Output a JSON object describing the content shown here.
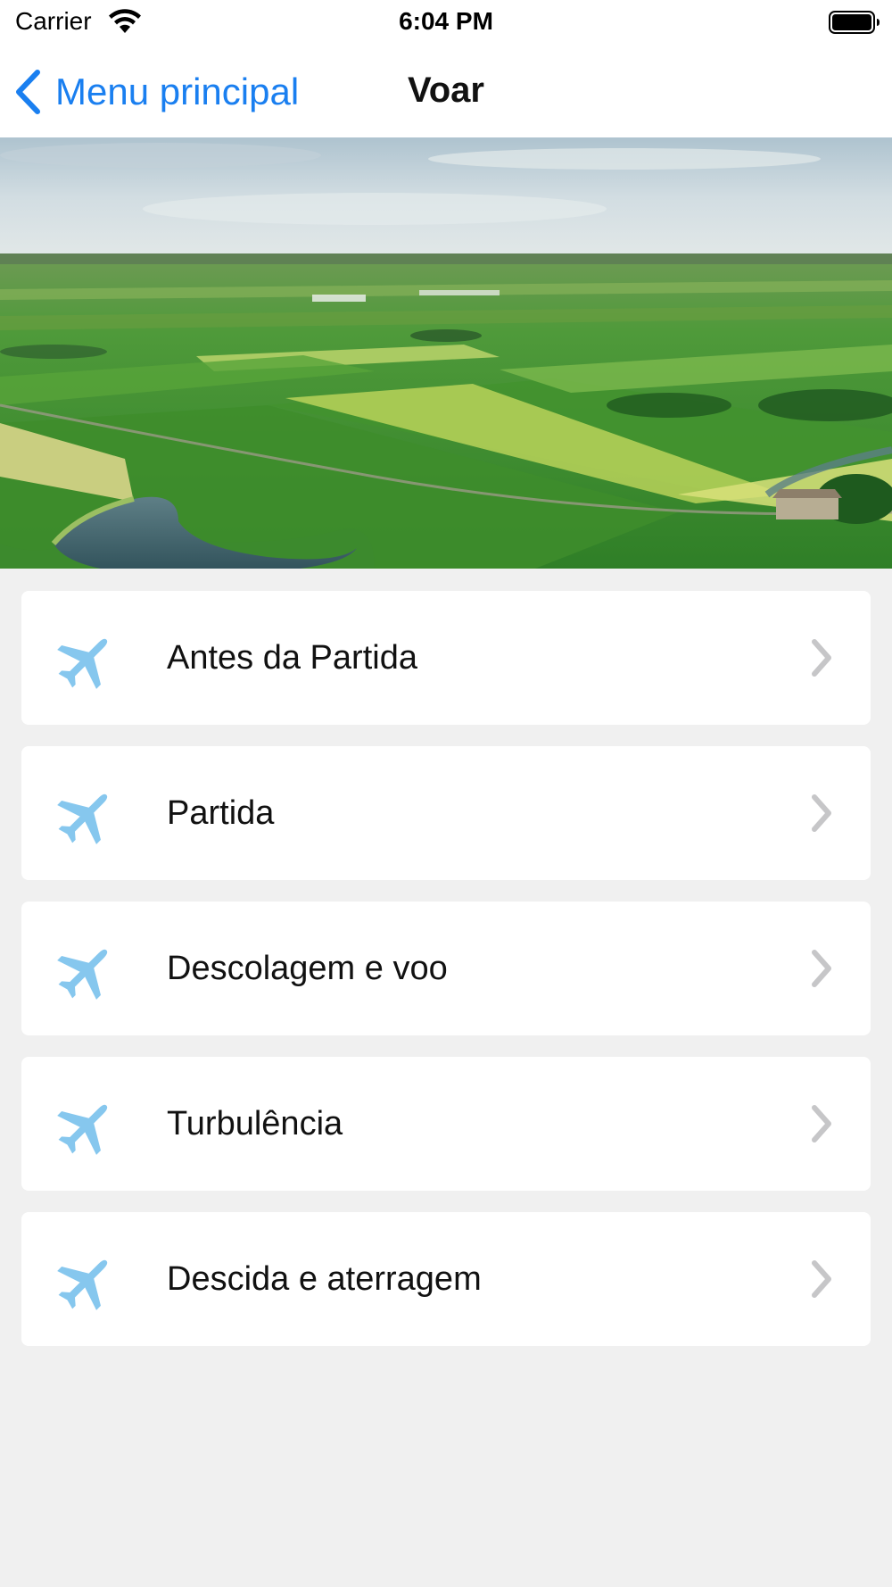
{
  "status_bar": {
    "carrier": "Carrier",
    "time": "6:04 PM",
    "icons": [
      "wifi-icon",
      "battery-icon"
    ]
  },
  "nav": {
    "back_label": "Menu principal",
    "title": "Voar"
  },
  "colors": {
    "accent": "#1a7ff0",
    "icon": "#86c7ee",
    "chevron": "#c6c6c8",
    "background": "#f0f0f0",
    "card": "#ffffff"
  },
  "menu": {
    "items": [
      {
        "label": "Antes da Partida",
        "icon": "airplane-icon"
      },
      {
        "label": "Partida",
        "icon": "airplane-icon"
      },
      {
        "label": "Descolagem e voo",
        "icon": "airplane-icon"
      },
      {
        "label": "Turbulência",
        "icon": "airplane-icon"
      },
      {
        "label": "Descida e aterragem",
        "icon": "airplane-icon"
      }
    ]
  }
}
